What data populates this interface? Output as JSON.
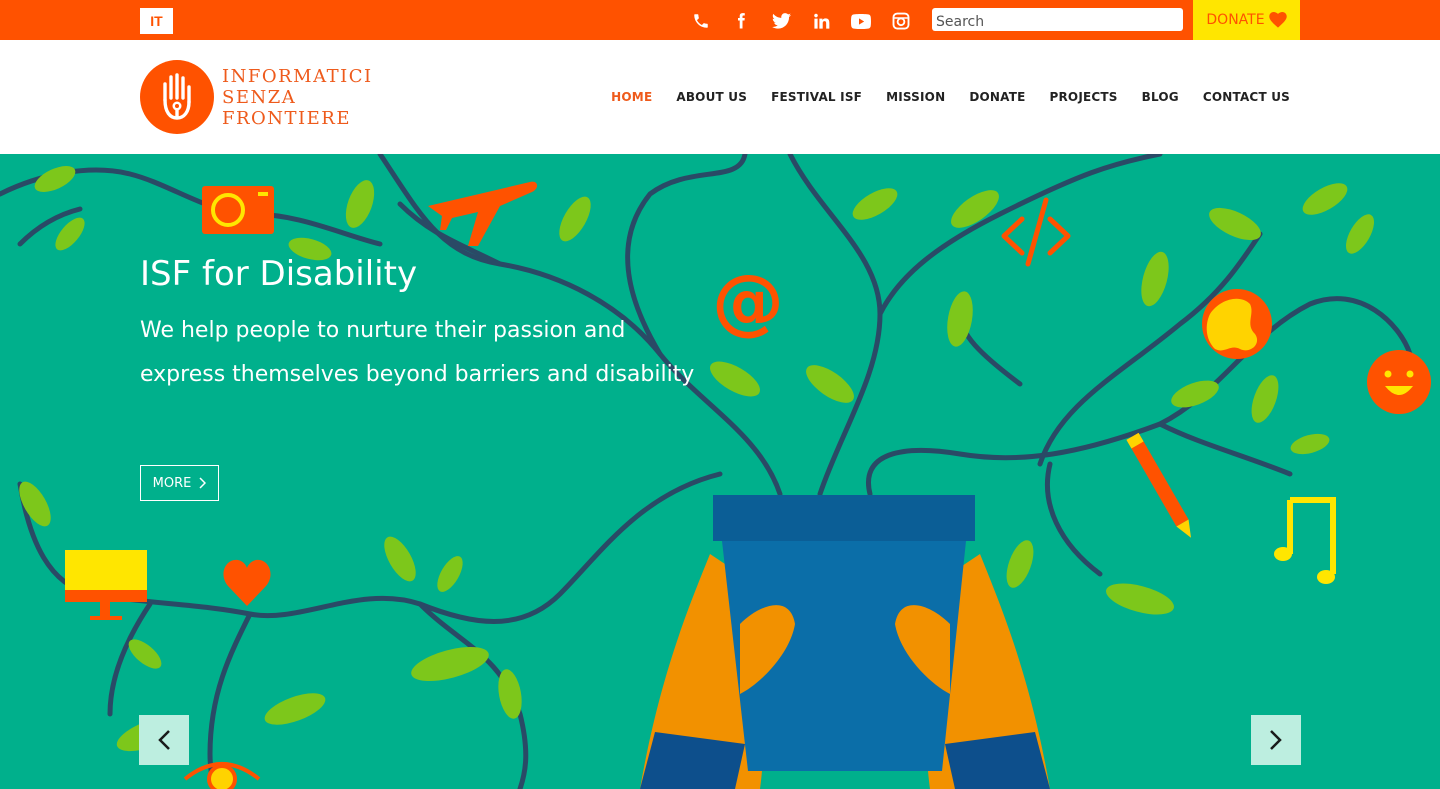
{
  "topbar": {
    "lang_label": "IT",
    "social_icons": [
      "phone-icon",
      "facebook-icon",
      "twitter-icon",
      "linkedin-icon",
      "youtube-icon",
      "instagram-icon"
    ],
    "search_placeholder": "Search",
    "donate_label": "DONATE"
  },
  "header": {
    "logo_lines": [
      "INFORMATICI",
      "SENZA",
      "FRONTIERE"
    ],
    "nav": [
      "HOME",
      "ABOUT US",
      "FESTIVAL ISF",
      "MISSION",
      "DONATE",
      "PROJECTS",
      "BLOG",
      "CONTACT US"
    ],
    "active_nav": "HOME"
  },
  "hero": {
    "title": "ISF for Disability",
    "subtitle": "We help people to nurture their passion and express themselves beyond barriers and disability",
    "more_label": "MORE"
  },
  "colors": {
    "brand_orange": "#ff5200",
    "donate_yellow": "#ffe600",
    "hero_green": "#00b08c",
    "nav_active": "#ee5a1b"
  }
}
